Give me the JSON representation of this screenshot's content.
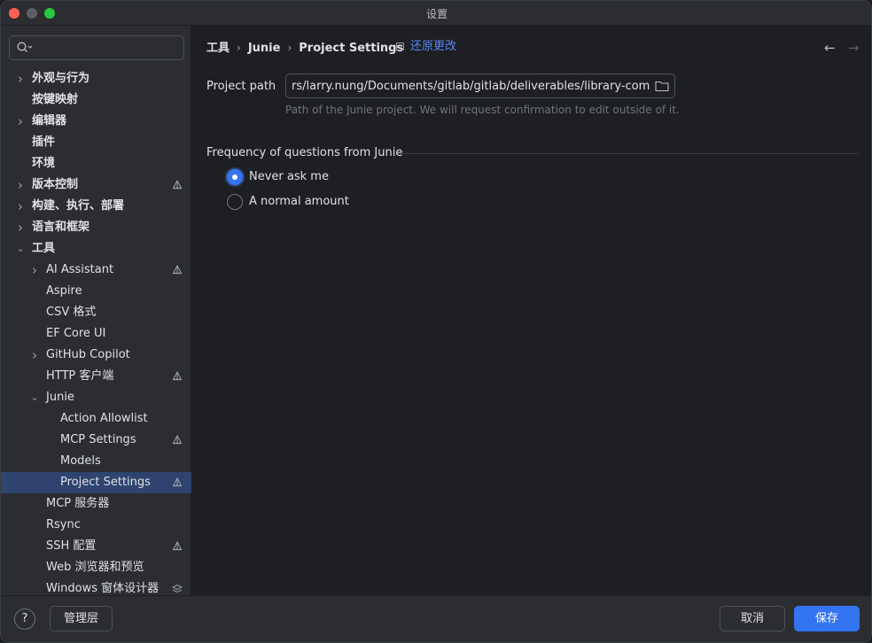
{
  "window": {
    "title": "设置"
  },
  "search": {
    "placeholder": ""
  },
  "sidebar": {
    "items": [
      {
        "label": "外观与行为",
        "bold": true,
        "chevron": "right",
        "indent": 0,
        "badge": false
      },
      {
        "label": "按键映射",
        "bold": true,
        "chevron": "none",
        "indent": 0,
        "badge": false
      },
      {
        "label": "编辑器",
        "bold": true,
        "chevron": "right",
        "indent": 0,
        "badge": false
      },
      {
        "label": "插件",
        "bold": true,
        "chevron": "none",
        "indent": 0,
        "badge": false
      },
      {
        "label": "环境",
        "bold": true,
        "chevron": "none",
        "indent": 0,
        "badge": false
      },
      {
        "label": "版本控制",
        "bold": true,
        "chevron": "right",
        "indent": 0,
        "badge": true
      },
      {
        "label": "构建、执行、部署",
        "bold": true,
        "chevron": "right",
        "indent": 0,
        "badge": false
      },
      {
        "label": "语言和框架",
        "bold": true,
        "chevron": "right",
        "indent": 0,
        "badge": false
      },
      {
        "label": "工具",
        "bold": true,
        "chevron": "down",
        "indent": 0,
        "badge": false
      },
      {
        "label": "AI Assistant",
        "bold": false,
        "chevron": "right",
        "indent": 1,
        "badge": true
      },
      {
        "label": "Aspire",
        "bold": false,
        "chevron": "none",
        "indent": 1,
        "badge": false
      },
      {
        "label": "CSV 格式",
        "bold": false,
        "chevron": "none",
        "indent": 1,
        "badge": false
      },
      {
        "label": "EF Core UI",
        "bold": false,
        "chevron": "none",
        "indent": 1,
        "badge": false
      },
      {
        "label": "GitHub Copilot",
        "bold": false,
        "chevron": "right",
        "indent": 1,
        "badge": false
      },
      {
        "label": "HTTP 客户端",
        "bold": false,
        "chevron": "none",
        "indent": 1,
        "badge": true
      },
      {
        "label": "Junie",
        "bold": false,
        "chevron": "down",
        "indent": 1,
        "badge": false
      },
      {
        "label": "Action Allowlist",
        "bold": false,
        "chevron": "none",
        "indent": 2,
        "badge": false
      },
      {
        "label": "MCP Settings",
        "bold": false,
        "chevron": "none",
        "indent": 2,
        "badge": true
      },
      {
        "label": "Models",
        "bold": false,
        "chevron": "none",
        "indent": 2,
        "badge": false
      },
      {
        "label": "Project Settings",
        "bold": false,
        "chevron": "none",
        "indent": 2,
        "badge": true,
        "selected": true
      },
      {
        "label": "MCP 服务器",
        "bold": false,
        "chevron": "none",
        "indent": 1,
        "badge": false
      },
      {
        "label": "Rsync",
        "bold": false,
        "chevron": "none",
        "indent": 1,
        "badge": false
      },
      {
        "label": "SSH 配置",
        "bold": false,
        "chevron": "none",
        "indent": 1,
        "badge": true
      },
      {
        "label": "Web 浏览器和预览",
        "bold": false,
        "chevron": "none",
        "indent": 1,
        "badge": false
      },
      {
        "label": "Windows 窗体设计器",
        "bold": false,
        "chevron": "none",
        "indent": 1,
        "badge": "layers"
      }
    ]
  },
  "breadcrumb": {
    "items": [
      "工具",
      "Junie",
      "Project Settings"
    ]
  },
  "revert": {
    "label": "还原更改"
  },
  "project_path": {
    "label": "Project path",
    "value": "rs/larry.nung/Documents/gitlab/gitlab/deliverables/library-common",
    "hint": "Path of the Junie project. We will request confirmation to edit outside of it."
  },
  "frequency": {
    "title": "Frequency of questions from Junie",
    "options": [
      {
        "label": "Never ask me",
        "selected": true
      },
      {
        "label": "A normal amount",
        "selected": false
      }
    ]
  },
  "footer": {
    "help_label": "?",
    "manage_label": "管理层",
    "cancel_label": "取消",
    "save_label": "保存"
  },
  "colors": {
    "accent": "#3574f0",
    "link": "#548af7",
    "selection": "#2e436e",
    "panel": "#2b2d30",
    "background": "#1e1f22"
  }
}
